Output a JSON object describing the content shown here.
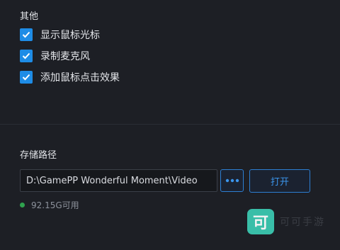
{
  "other_section": {
    "title": "其他",
    "options": [
      {
        "label": "显示鼠标光标",
        "checked": true
      },
      {
        "label": "录制麦克风",
        "checked": true
      },
      {
        "label": "添加鼠标点击效果",
        "checked": true
      }
    ]
  },
  "storage_section": {
    "title": "存储路径",
    "path_value": "D:\\GamePP Wonderful Moment\\Video",
    "browse_icon": "ellipsis-icon",
    "open_label": "打开",
    "available": "92.15G可用"
  },
  "watermark": {
    "logo_char": "可",
    "text": "可可手游"
  },
  "colors": {
    "background": "#1d1f25",
    "accent": "#1e8ce6",
    "status_ok": "#2fa24e"
  }
}
